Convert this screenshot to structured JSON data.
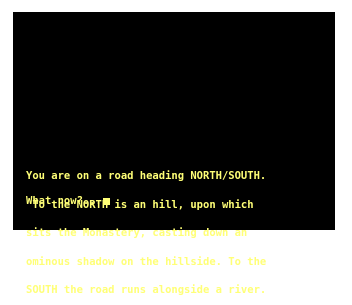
{
  "narration": {
    "lines": [
      "You are on a road heading NORTH/SOUTH.",
      " To the NORTH is an hill, upon which",
      "sits the Monastery, casting down an",
      "ominous shadow on the hillside. To the",
      "SOUTH the road runs alongside a river."
    ]
  },
  "prompt": {
    "label": "What now?..."
  },
  "colors": {
    "background": "#000000",
    "text": "#ffff77",
    "border": "#ffffff"
  }
}
